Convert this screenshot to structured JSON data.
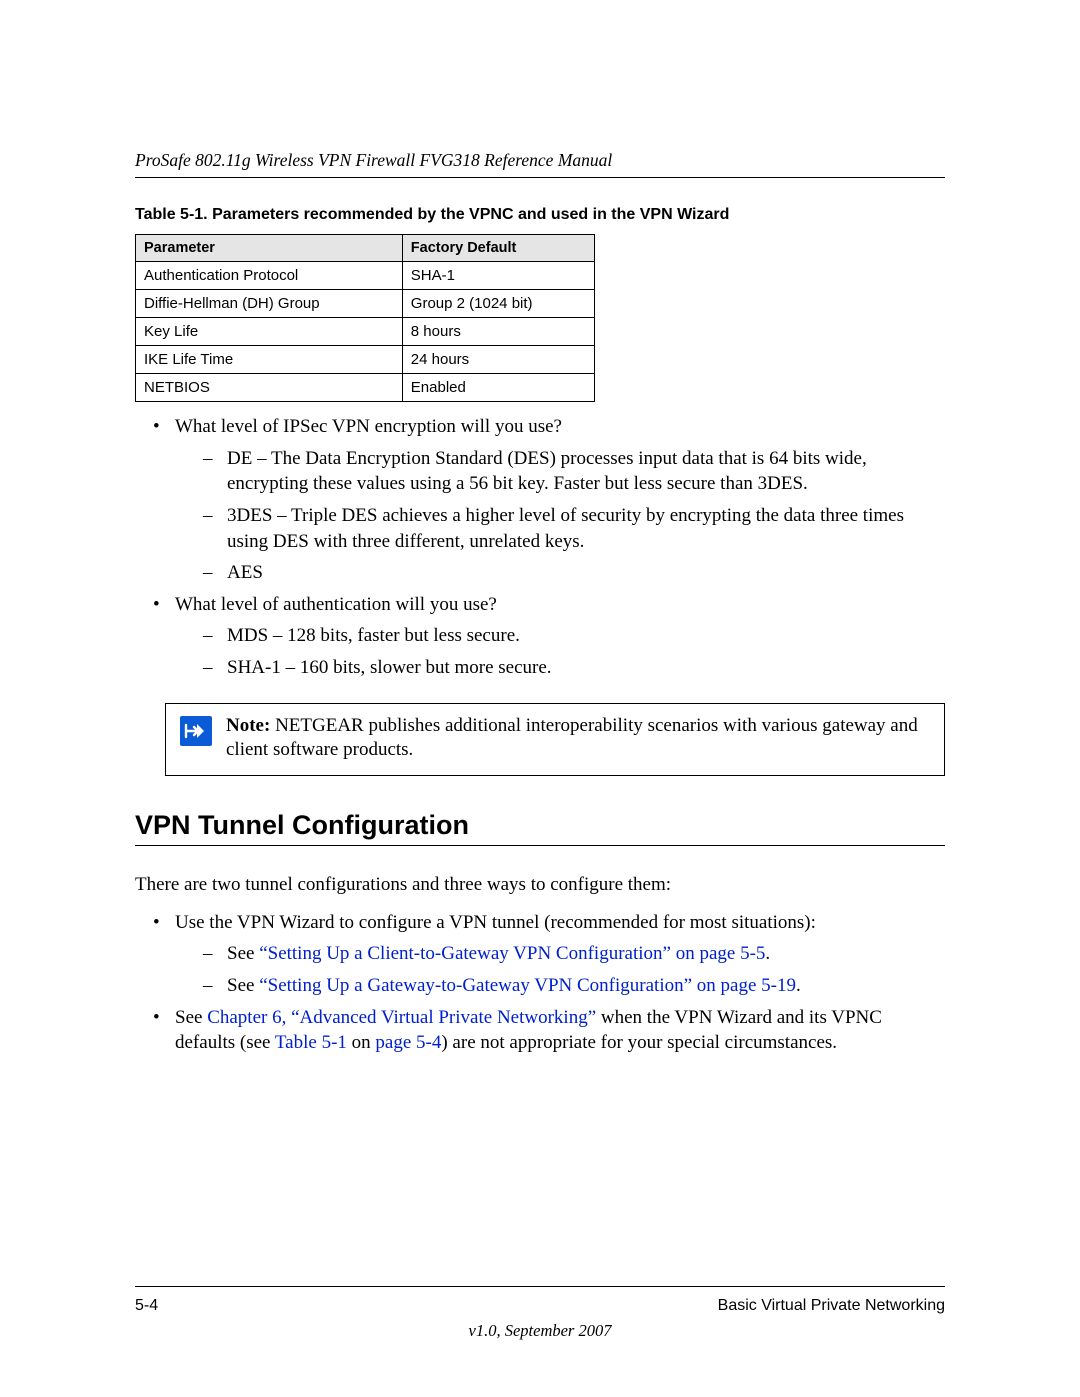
{
  "header": {
    "running": "ProSafe 802.11g Wireless VPN Firewall FVG318 Reference Manual"
  },
  "table": {
    "caption": "Table 5-1. Parameters recommended by the VPNC and used in the VPN Wizard",
    "headers": {
      "p": "Parameter",
      "d": "Factory Default"
    },
    "rows": [
      {
        "p": "Authentication Protocol",
        "d": "SHA-1"
      },
      {
        "p": "Diffie-Hellman (DH) Group",
        "d": "Group 2 (1024 bit)"
      },
      {
        "p": "Key Life",
        "d": "8 hours"
      },
      {
        "p": "IKE Life Time",
        "d": "24 hours"
      },
      {
        "p": "NETBIOS",
        "d": "Enabled"
      }
    ]
  },
  "content": {
    "q1": "What level of IPSec VPN encryption will you use?",
    "q1_items": {
      "de": "DE – The Data Encryption Standard (DES) processes input data that is 64 bits wide, encrypting these values using a 56 bit key. Faster but less secure than 3DES.",
      "tdes": "3DES – Triple DES achieves a higher level of security by encrypting the data three times using DES with three different, unrelated keys.",
      "aes": "AES"
    },
    "q2": "What level of authentication will you use?",
    "q2_items": {
      "mds": "MDS – 128 bits, faster but less secure.",
      "sha": "SHA-1 – 160 bits, slower but more secure."
    }
  },
  "note": {
    "label": "Note:",
    "text": " NETGEAR publishes additional interoperability scenarios with various gateway and client software products."
  },
  "section2": {
    "title": "VPN Tunnel Configuration",
    "intro": "There are two tunnel configurations and three ways to configure them:",
    "b1": "Use the VPN Wizard to configure a VPN tunnel (recommended for most situations):",
    "see": "See ",
    "link1": "“Setting Up a Client-to-Gateway VPN Configuration” on page 5-5",
    "link2": "“Setting Up a Gateway-to-Gateway VPN Configuration” on page 5-19",
    "period": ".",
    "b2a": "See ",
    "b2link": "Chapter 6, “Advanced Virtual Private Networking”",
    "b2b": " when the VPN Wizard and its VPNC defaults (see ",
    "b2link2a": "Table 5-1",
    "b2mid": " on ",
    "b2link2b": "page 5-4",
    "b2c": ") are not appropriate for your special circumstances."
  },
  "footer": {
    "pagenum": "5-4",
    "chapter": "Basic Virtual Private Networking",
    "version": "v1.0, September 2007"
  }
}
